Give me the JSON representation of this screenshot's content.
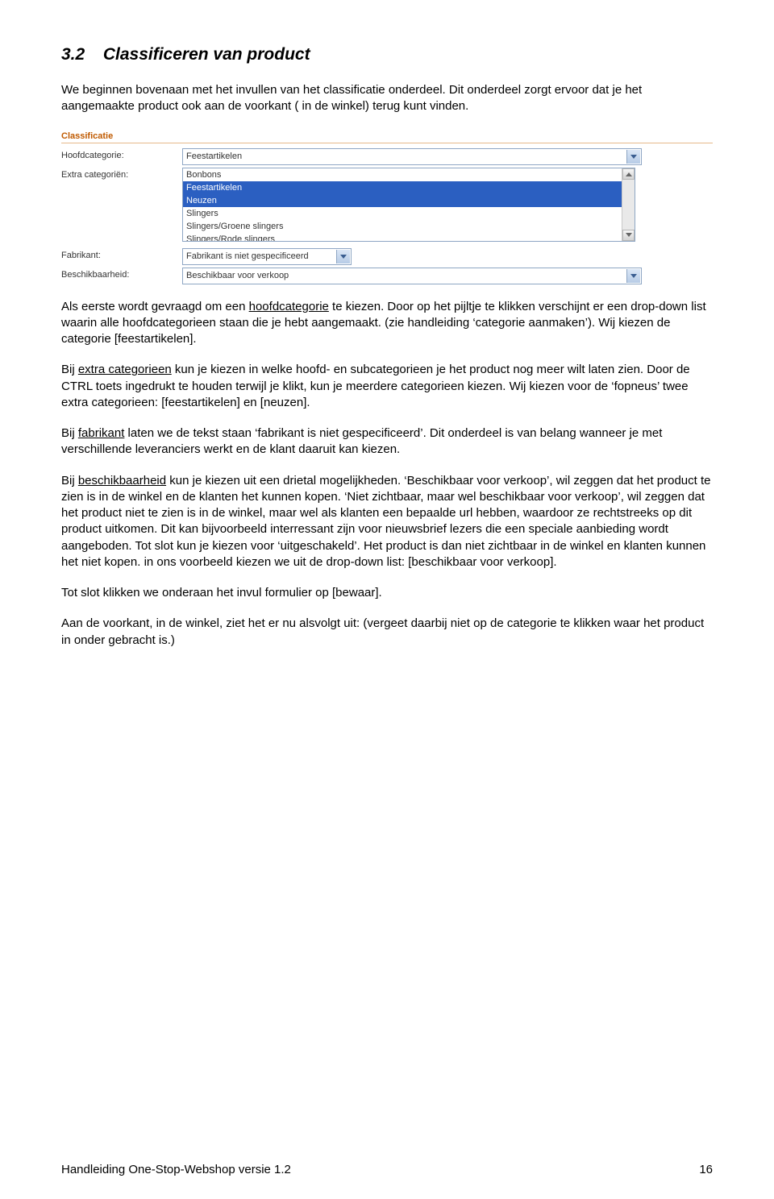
{
  "heading": {
    "num": "3.2",
    "title": "Classificeren van product"
  },
  "intro": "We beginnen bovenaan met het invullen van het classificatie onderdeel. Dit onderdeel zorgt ervoor dat je het aangemaakte product ook aan de voorkant ( in de winkel) terug kunt vinden.",
  "form": {
    "section": "Classificatie",
    "mainCat": {
      "label": "Hoofdcategorie:",
      "value": "Feestartikelen"
    },
    "extraCat": {
      "label": "Extra categoriën:",
      "options": [
        "Bonbons",
        "Feestartikelen",
        "Neuzen",
        "Slingers",
        "Slingers/Groene slingers",
        "Slingers/Rode slingers"
      ],
      "selected": [
        1,
        2
      ]
    },
    "manufacturer": {
      "label": "Fabrikant:",
      "value": "Fabrikant is niet gespecificeerd"
    },
    "availability": {
      "label": "Beschikbaarheid:",
      "value": "Beschikbaar voor verkoop"
    }
  },
  "p1": {
    "pre": "Als eerste wordt gevraagd om een ",
    "u": "hoofdcategorie",
    "post": " te kiezen. Door op het pijltje te klikken verschijnt er een drop-down list waarin alle hoofdcategorieen staan die je hebt aangemaakt. (zie handleiding ‘categorie aanmaken’). Wij kiezen de categorie [feestartikelen]."
  },
  "p2": {
    "pre": "Bij ",
    "u": "extra categorieen",
    "post": " kun je kiezen in welke hoofd- en subcategorieen je het product nog meer wilt laten zien. Door de CTRL toets ingedrukt te houden terwijl je klikt, kun je meerdere categorieen kiezen. Wij kiezen voor de ‘fopneus’ twee extra categorieen: [feestartikelen] en [neuzen]."
  },
  "p3": {
    "pre": "Bij ",
    "u": "fabrikant",
    "post": " laten we de tekst staan ‘fabrikant is niet gespecificeerd’. Dit onderdeel is van belang wanneer je met verschillende leveranciers werkt en de klant daaruit kan kiezen."
  },
  "p4": {
    "pre": "Bij ",
    "u": "beschikbaarheid",
    "post": " kun je kiezen uit een drietal mogelijkheden. ‘Beschikbaar voor verkoop’, wil zeggen dat het product te zien is in de winkel en de klanten het kunnen kopen. ‘Niet zichtbaar, maar wel beschikbaar voor verkoop’, wil zeggen dat het product niet te zien is in de winkel, maar wel als klanten een bepaalde url hebben, waardoor ze rechtstreeks op dit product uitkomen. Dit kan bijvoorbeeld interressant zijn voor nieuwsbrief lezers die een speciale aanbieding wordt aangeboden. Tot slot kun je kiezen voor ‘uitgeschakeld’. Het product is dan niet zichtbaar in de winkel en klanten kunnen het niet kopen.  in ons voorbeeld kiezen we uit de drop-down list: [beschikbaar voor verkoop]."
  },
  "p5": "Tot slot klikken we onderaan het invul formulier op [bewaar].",
  "p6": "Aan de voorkant, in de winkel, ziet het er nu alsvolgt uit: (vergeet daarbij niet op de categorie te klikken waar het product in onder gebracht is.)",
  "footer": {
    "left": "Handleiding One-Stop-Webshop versie 1.2",
    "right": "16"
  }
}
